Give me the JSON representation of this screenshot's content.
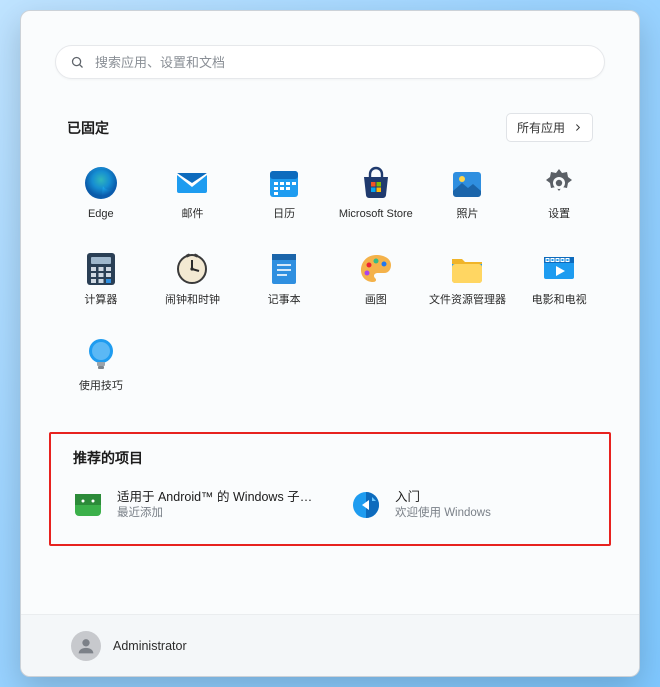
{
  "search": {
    "placeholder": "搜索应用、设置和文档"
  },
  "sections": {
    "pinned_title": "已固定",
    "all_apps_label": "所有应用",
    "recommended_title": "推荐的项目"
  },
  "pinned": [
    {
      "id": "edge",
      "label": "Edge"
    },
    {
      "id": "mail",
      "label": "邮件"
    },
    {
      "id": "calendar",
      "label": "日历"
    },
    {
      "id": "store",
      "label": "Microsoft Store"
    },
    {
      "id": "photos",
      "label": "照片"
    },
    {
      "id": "settings",
      "label": "设置"
    },
    {
      "id": "calculator",
      "label": "计算器"
    },
    {
      "id": "clock",
      "label": "闹钟和时钟"
    },
    {
      "id": "notepad",
      "label": "记事本"
    },
    {
      "id": "paint",
      "label": "画图"
    },
    {
      "id": "explorer",
      "label": "文件资源管理器"
    },
    {
      "id": "movies",
      "label": "电影和电视"
    },
    {
      "id": "tips",
      "label": "使用技巧"
    }
  ],
  "recommended": [
    {
      "id": "wsa",
      "title": "适用于 Android™ 的 Windows 子系...",
      "sub": "最近添加"
    },
    {
      "id": "getstarted",
      "title": "入门",
      "sub": "欢迎使用 Windows"
    }
  ],
  "user": {
    "name": "Administrator"
  }
}
